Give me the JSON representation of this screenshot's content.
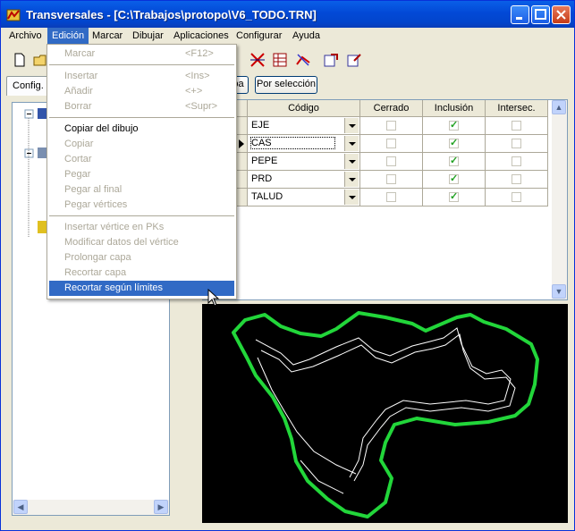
{
  "window": {
    "title": "Transversales - [C:\\Trabajos\\protopo\\V6_TODO.TRN]"
  },
  "menubar": [
    "Archivo",
    "Edición",
    "Marcar",
    "Dibujar",
    "Aplicaciones",
    "Configurar",
    "Ayuda"
  ],
  "edicion_menu": [
    {
      "label": "Marcar",
      "shortcut": "<F12>",
      "enabled": false
    },
    {
      "sep": true
    },
    {
      "label": "Insertar",
      "shortcut": "<Ins>",
      "enabled": false
    },
    {
      "label": "Añadir",
      "shortcut": "<+>",
      "enabled": false
    },
    {
      "label": "Borrar",
      "shortcut": "<Supr>",
      "enabled": false
    },
    {
      "sep": true
    },
    {
      "label": "Copiar del dibujo",
      "shortcut": "",
      "enabled": true
    },
    {
      "label": "Copiar",
      "shortcut": "",
      "enabled": false
    },
    {
      "label": "Cortar",
      "shortcut": "",
      "enabled": false
    },
    {
      "label": "Pegar",
      "shortcut": "",
      "enabled": false
    },
    {
      "label": "Pegar al final",
      "shortcut": "",
      "enabled": false
    },
    {
      "label": "Pegar vértices",
      "shortcut": "",
      "enabled": false
    },
    {
      "sep": true
    },
    {
      "label": "Insertar vértice en PKs",
      "shortcut": "",
      "enabled": false
    },
    {
      "label": "Modificar datos del vértice",
      "shortcut": "",
      "enabled": false
    },
    {
      "label": "Prolongar capa",
      "shortcut": "",
      "enabled": false
    },
    {
      "label": "Recortar capa",
      "shortcut": "",
      "enabled": false
    },
    {
      "label": "Recortar según límites",
      "shortcut": "",
      "enabled": true,
      "highlighted": true
    }
  ],
  "tabs": {
    "config": "Config."
  },
  "buttons": {
    "partial": "pa",
    "por_seleccion": "Por selección"
  },
  "grid": {
    "columns": [
      "Código",
      "Cerrado",
      "Inclusión",
      "Intersec."
    ],
    "rows": [
      {
        "codigo": "EJE",
        "cerrado": false,
        "inclusion": true,
        "intersec": false
      },
      {
        "codigo": "CAS",
        "cerrado": false,
        "inclusion": true,
        "intersec": false,
        "current": true
      },
      {
        "codigo": "PEPE",
        "cerrado": false,
        "inclusion": true,
        "intersec": false
      },
      {
        "codigo": "PRD",
        "cerrado": false,
        "inclusion": true,
        "intersec": false
      },
      {
        "codigo": "TALUD",
        "cerrado": false,
        "inclusion": true,
        "intersec": false
      }
    ]
  },
  "colors": {
    "boundary": "#22d63a",
    "lines": "#ffffff",
    "canvas_bg": "#000000",
    "menu_highlight": "#316ac5"
  }
}
